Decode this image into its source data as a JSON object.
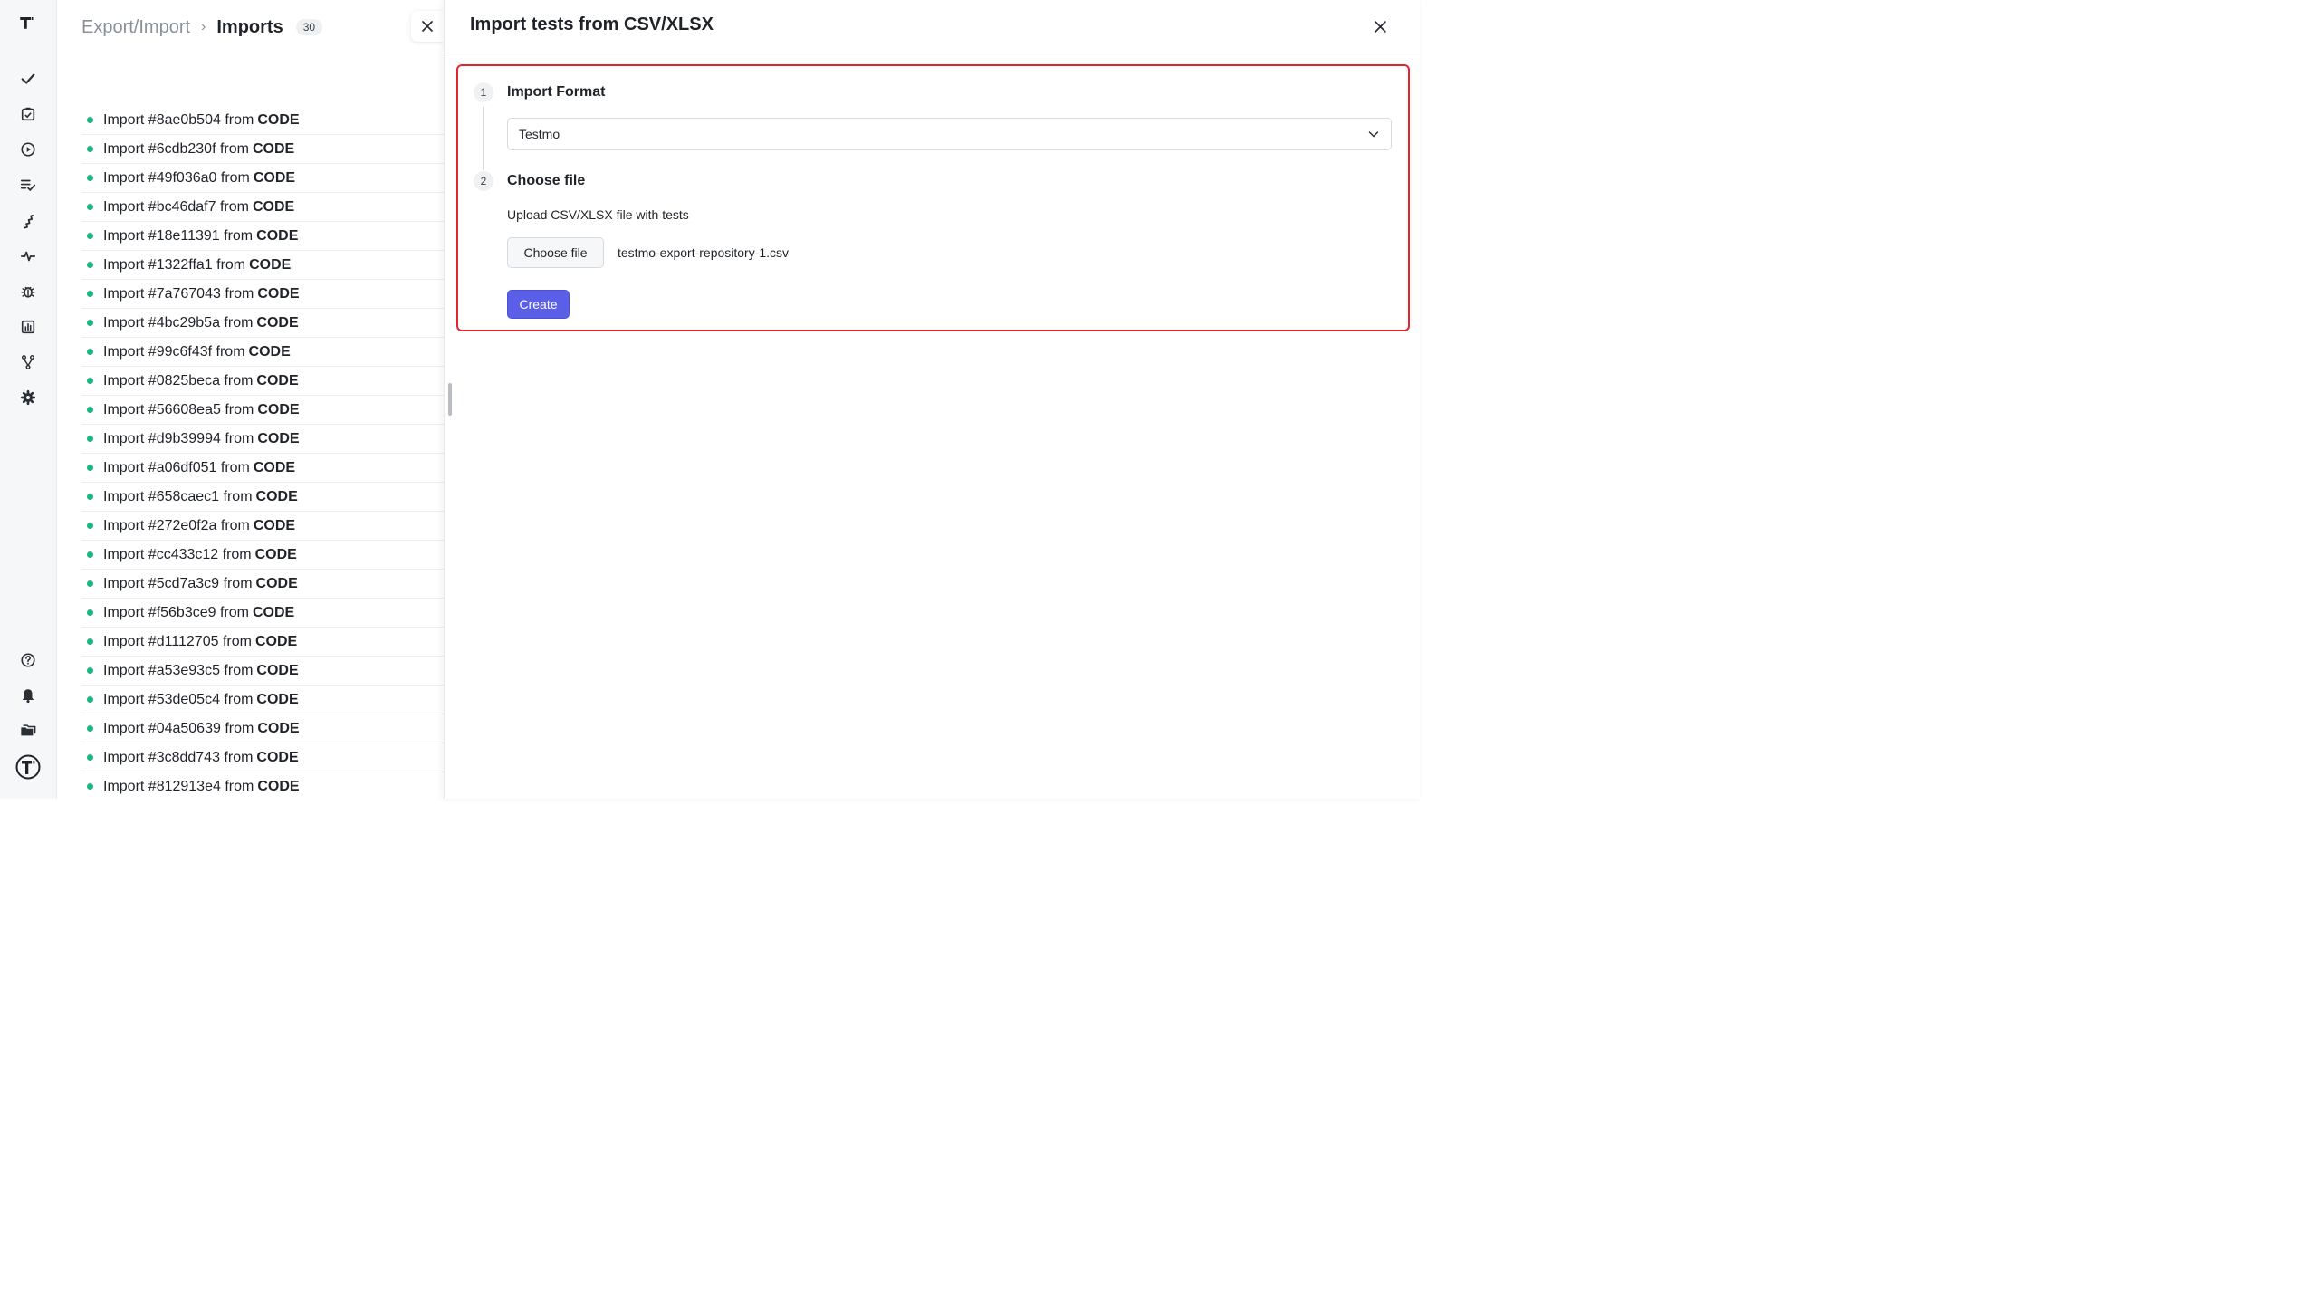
{
  "app": {
    "logo_text": "T"
  },
  "rail": {
    "items": [
      {
        "name": "check-icon"
      },
      {
        "name": "clipboard-check-icon"
      },
      {
        "name": "play-circle-icon"
      },
      {
        "name": "list-check-icon"
      },
      {
        "name": "stairs-icon"
      },
      {
        "name": "activity-icon"
      },
      {
        "name": "bug-icon"
      },
      {
        "name": "bar-chart-icon"
      },
      {
        "name": "branch-icon"
      },
      {
        "name": "gear-icon"
      }
    ],
    "bottom_items": [
      {
        "name": "help-icon"
      },
      {
        "name": "bell-icon"
      },
      {
        "name": "folders-icon"
      },
      {
        "name": "profile-logo-icon"
      }
    ]
  },
  "breadcrumb": {
    "parent": "Export/Import",
    "separator": "›",
    "current": "Imports",
    "count": "30"
  },
  "imports": [
    {
      "label": "Import #8ae0b504 from",
      "source": "CODE"
    },
    {
      "label": "Import #6cdb230f from",
      "source": "CODE"
    },
    {
      "label": "Import #49f036a0 from",
      "source": "CODE"
    },
    {
      "label": "Import #bc46daf7 from",
      "source": "CODE"
    },
    {
      "label": "Import #18e11391 from",
      "source": "CODE"
    },
    {
      "label": "Import #1322ffa1 from",
      "source": "CODE"
    },
    {
      "label": "Import #7a767043 from",
      "source": "CODE"
    },
    {
      "label": "Import #4bc29b5a from",
      "source": "CODE"
    },
    {
      "label": "Import #99c6f43f from",
      "source": "CODE"
    },
    {
      "label": "Import #0825beca from",
      "source": "CODE"
    },
    {
      "label": "Import #56608ea5 from",
      "source": "CODE"
    },
    {
      "label": "Import #d9b39994 from",
      "source": "CODE"
    },
    {
      "label": "Import #a06df051 from",
      "source": "CODE"
    },
    {
      "label": "Import #658caec1 from",
      "source": "CODE"
    },
    {
      "label": "Import #272e0f2a from",
      "source": "CODE"
    },
    {
      "label": "Import #cc433c12 from",
      "source": "CODE"
    },
    {
      "label": "Import #5cd7a3c9 from",
      "source": "CODE"
    },
    {
      "label": "Import #f56b3ce9 from",
      "source": "CODE"
    },
    {
      "label": "Import #d1112705 from",
      "source": "CODE"
    },
    {
      "label": "Import #a53e93c5 from",
      "source": "CODE"
    },
    {
      "label": "Import #53de05c4 from",
      "source": "CODE"
    },
    {
      "label": "Import #04a50639 from",
      "source": "CODE"
    },
    {
      "label": "Import #3c8dd743 from",
      "source": "CODE"
    },
    {
      "label": "Import #812913e4 from",
      "source": "CODE"
    }
  ],
  "drawer": {
    "title": "Import tests from CSV/XLSX",
    "step1": {
      "number": "1",
      "title": "Import Format",
      "selected_format": "Testmo"
    },
    "step2": {
      "number": "2",
      "title": "Choose file",
      "upload_label": "Upload CSV/XLSX file with tests",
      "choose_button": "Choose file",
      "file_name": "testmo-export-repository-1.csv"
    },
    "create_button": "Create"
  },
  "colors": {
    "accent": "#5b5fe8",
    "status_dot": "#18b77f",
    "highlight_border": "#e5242c"
  }
}
